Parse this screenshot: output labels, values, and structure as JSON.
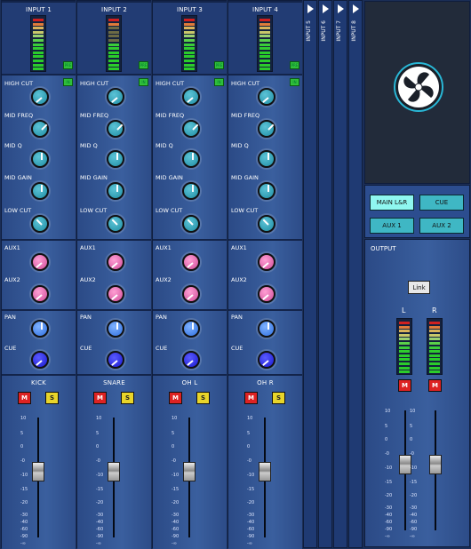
{
  "channels": [
    {
      "input": "INPUT 1",
      "name": "KICK"
    },
    {
      "input": "INPUT 2",
      "name": "SNARE"
    },
    {
      "input": "INPUT 3",
      "name": "OH L"
    },
    {
      "input": "INPUT 4",
      "name": "OH R"
    }
  ],
  "collapsed_inputs": [
    "INPUT 5",
    "INPUT 6",
    "INPUT 7",
    "INPUT 8"
  ],
  "labels": {
    "high_cut": "HIGH CUT",
    "mid_freq": "MID FREQ",
    "mid_q": "MID Q",
    "mid_gain": "MID GAIN",
    "low_cut": "LOW CUT",
    "aux1": "AUX1",
    "aux2": "AUX2",
    "pan": "PAN",
    "cue": "CUE",
    "mute": "M",
    "solo": "S",
    "in_badge": "IN",
    "pre_badge": "PRE"
  },
  "fader_scale": [
    "10",
    "5",
    "0",
    "-0",
    "-10",
    "-15",
    "-20",
    "-30",
    "-40",
    "-60",
    "-90",
    "-∞"
  ],
  "buses": {
    "main": "MAIN L&R",
    "cue": "CUE",
    "aux1": "AUX 1",
    "aux2": "AUX 2"
  },
  "output": {
    "title": "OUTPUT",
    "link": "Link",
    "left": "L",
    "right": "R",
    "mute": "M"
  },
  "colors": {
    "strip": "#1f3a73",
    "eq_knob": "#2aa0b8",
    "aux_knob": "#e05aa8",
    "pan_knob": "#4a86f0",
    "cue_knob": "#2020e0",
    "selected_bus": "#8ff7f0",
    "bus": "#3fb7c4"
  }
}
